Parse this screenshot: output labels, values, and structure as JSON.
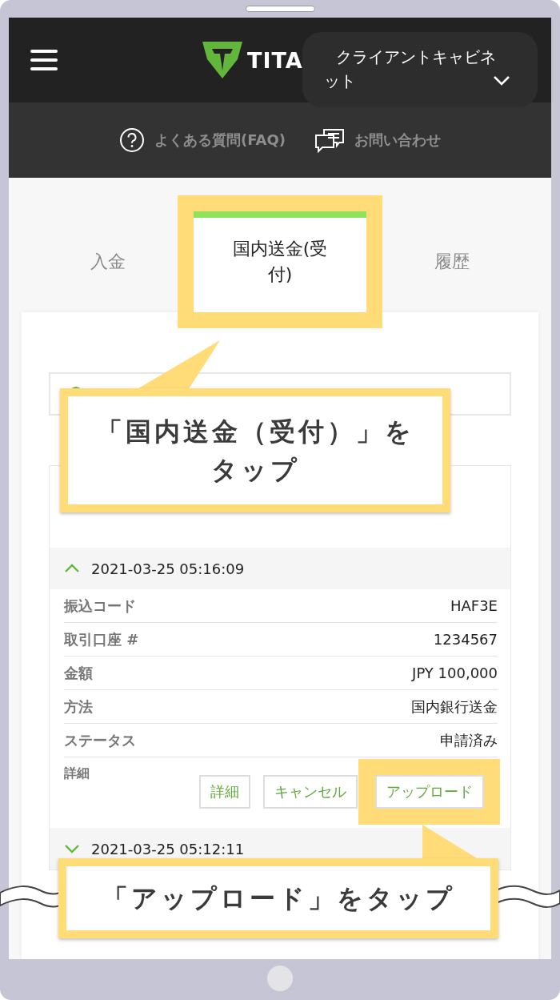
{
  "header": {
    "logo": "TITA",
    "account_menu": "クライアントキャビネット"
  },
  "links": [
    {
      "kind": "faq",
      "label": "よくある質問(FAQ)"
    },
    {
      "kind": "contact",
      "label": "お問い合わせ"
    }
  ],
  "tabs": [
    {
      "label": "入金",
      "selected": false
    },
    {
      "label": "国内送金(受付)",
      "selected": true
    },
    {
      "label": "履歴",
      "selected": false
    }
  ],
  "transactions": [
    {
      "datetime": "2021-03-25 05:16:09",
      "expanded": true,
      "fields": [
        {
          "label": "振込コード",
          "value": "HAF3E"
        },
        {
          "label": "取引口座 #",
          "value": "1234567"
        },
        {
          "label": "金額",
          "value": "JPY 100,000"
        },
        {
          "label": "方法",
          "value": "国内銀行送金"
        },
        {
          "label": "ステータス",
          "value": "申請済み"
        }
      ],
      "detail_label": "詳細",
      "actions": [
        {
          "label": "詳細",
          "highlighted": false
        },
        {
          "label": "キャンセル",
          "highlighted": false
        },
        {
          "label": "アップロード",
          "highlighted": true
        }
      ]
    },
    {
      "datetime": "2021-03-25 05:12:11",
      "expanded": false
    }
  ],
  "callouts": [
    {
      "lines": [
        "「国内送金（受付）」を",
        "タップ"
      ]
    },
    {
      "lines": [
        "「アップロード」をタップ"
      ]
    }
  ]
}
